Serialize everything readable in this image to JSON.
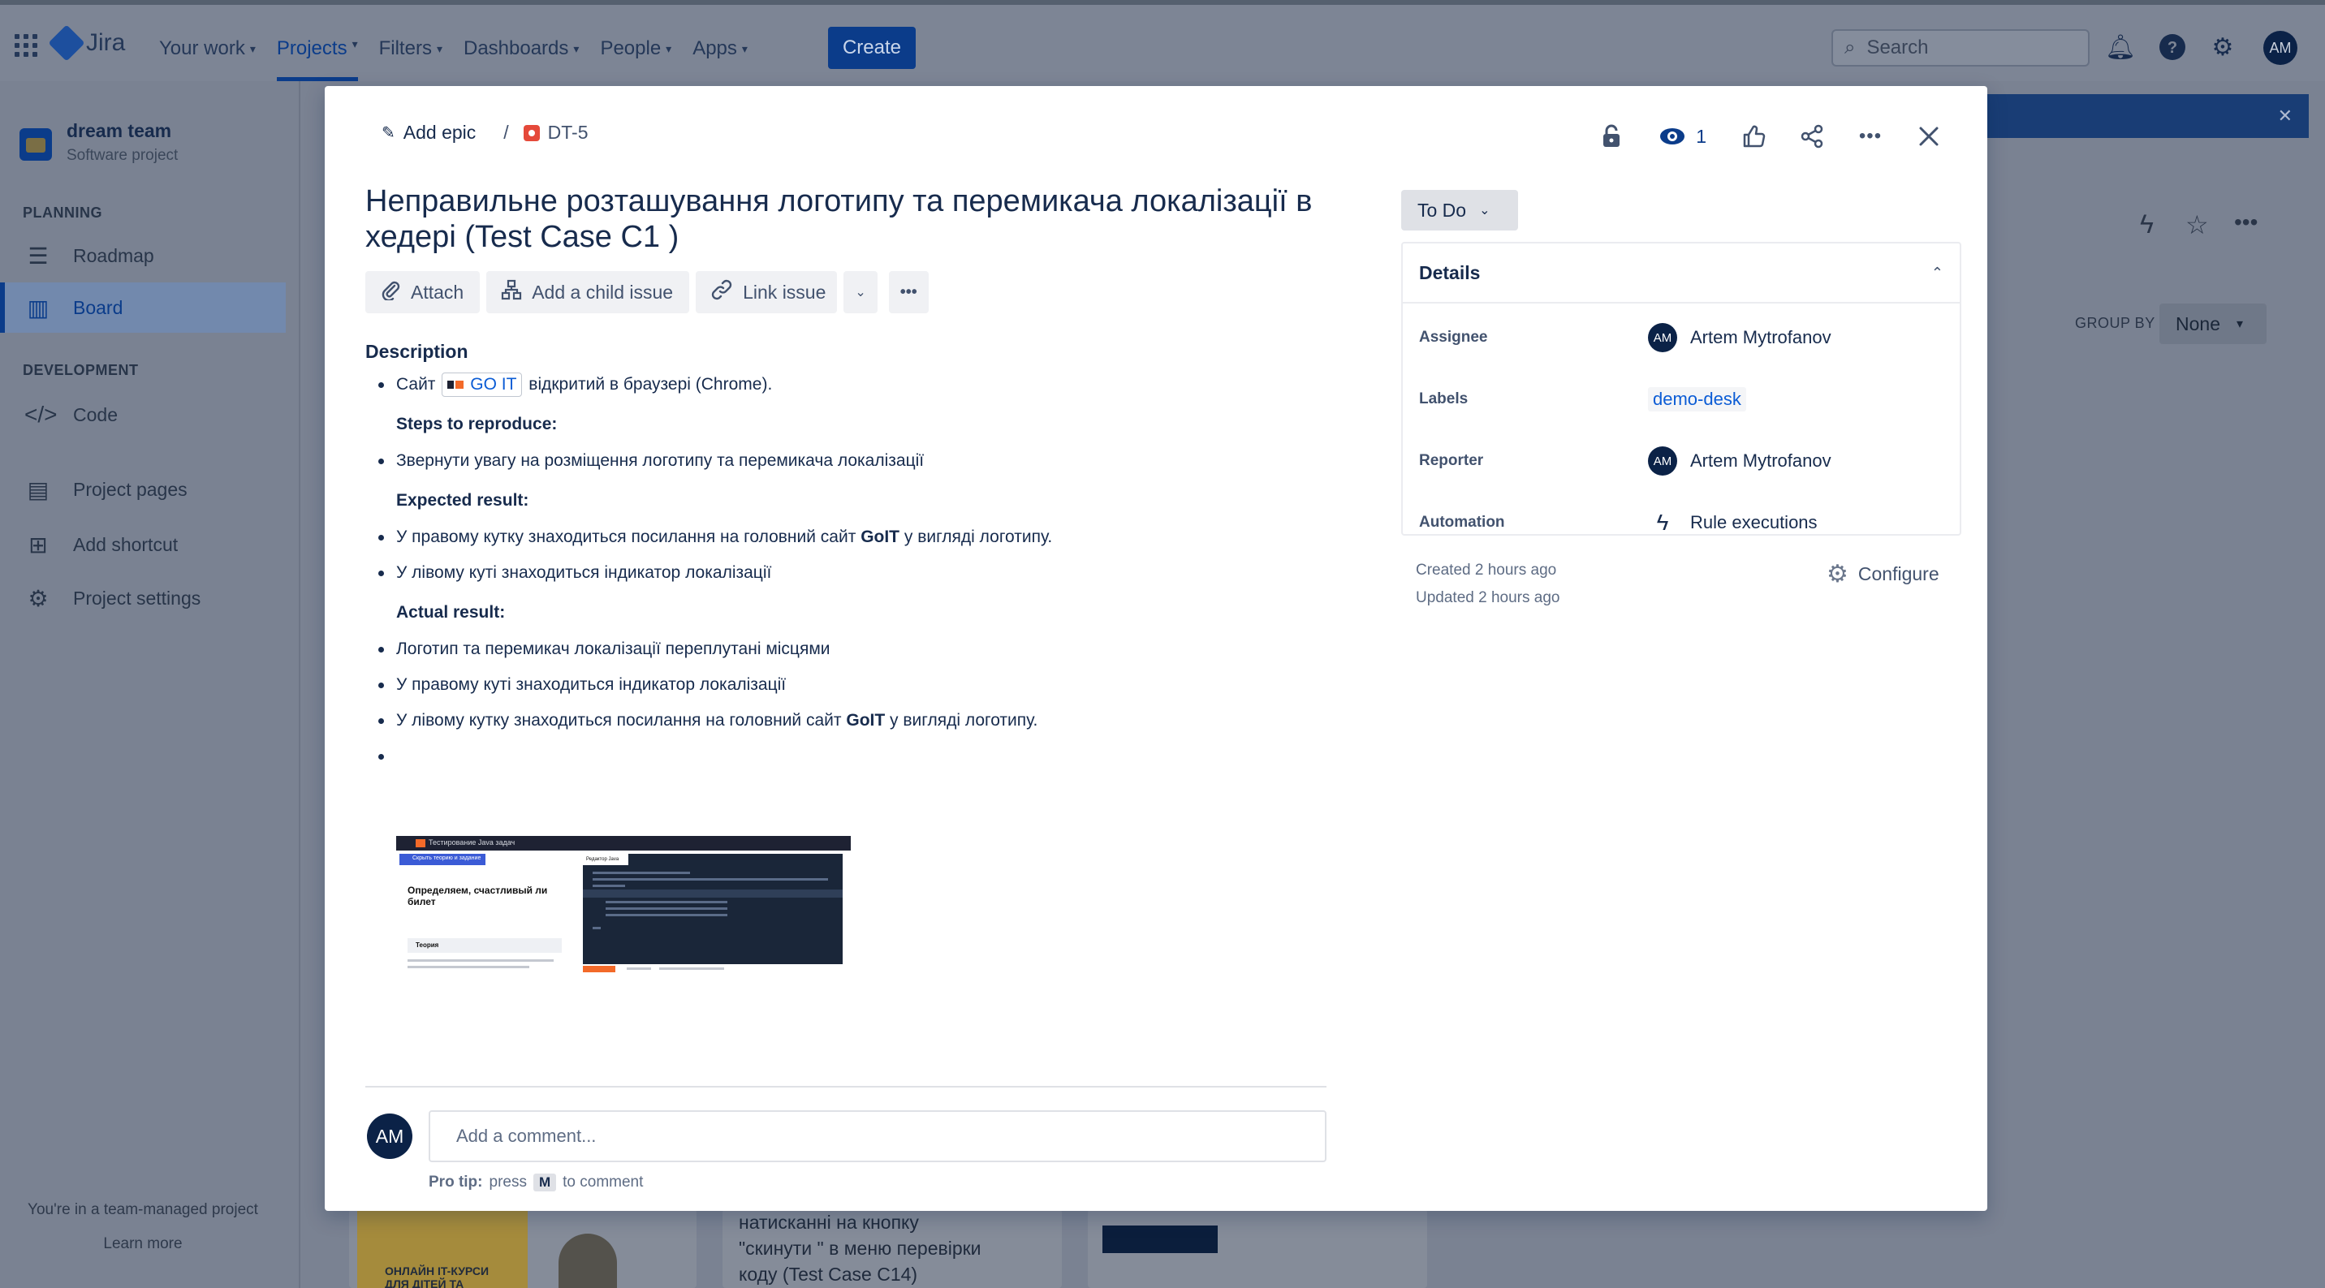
{
  "topbar": {
    "logo": "Jira",
    "nav": [
      {
        "label": "Your work",
        "active": false
      },
      {
        "label": "Projects",
        "active": true
      },
      {
        "label": "Filters",
        "active": false
      },
      {
        "label": "Dashboards",
        "active": false
      },
      {
        "label": "People",
        "active": false
      },
      {
        "label": "Apps",
        "active": false
      }
    ],
    "create_label": "Create",
    "search_placeholder": "Search",
    "avatar_initials": "AM"
  },
  "sidebar": {
    "project_name": "dream team",
    "project_type": "Software project",
    "planning_heading": "PLANNING",
    "roadmap": "Roadmap",
    "board": "Board",
    "development_heading": "DEVELOPMENT",
    "code": "Code",
    "project_pages": "Project pages",
    "add_shortcut": "Add shortcut",
    "project_settings": "Project settings",
    "footer_text": "You're in a team-managed project",
    "learn_more": "Learn more"
  },
  "background": {
    "group_by_label": "GROUP BY",
    "group_by_value": "None",
    "card_text": [
      "натисканні на кнопку",
      "\"скинути \" в меню перевірки",
      "коду (Test Case C14)"
    ],
    "yellow_card_text": [
      "ОНЛАЙН IT-КУРСИ",
      "ДЛЯ ДІТЕЙ ТА"
    ]
  },
  "issue": {
    "add_epic": "Add epic",
    "breadcrumb_sep": "/",
    "key": "DT-5",
    "watchers": "1",
    "title": "Неправильне розташування логотипу та перемикача локалізації в хедері (Test Case C1 )",
    "toolbar": {
      "attach": "Attach",
      "add_child": "Add a child issue",
      "link_issue": "Link issue"
    },
    "description_heading": "Description",
    "description": {
      "site_prefix": "Сайт",
      "site_link": "GO IT",
      "site_suffix": "відкритий в браузері (Chrome).",
      "steps_heading": "Steps to reproduce:",
      "step_1": "Звернути увагу на розміщення логотипу та перемикача локалізації",
      "expected_heading": "Expected result:",
      "expected_1_pre": "У правому кутку знаходиться посилання на головний сайт",
      "expected_1_bold": "GoIT",
      "expected_1_post": "у вигляді логотипу.",
      "expected_2": "У лівому куті знаходиться індикатор локалізації",
      "actual_heading": "Actual result:",
      "actual_1": "Логотип та перемикач локалізації переплутані місцями",
      "actual_2": "У правому куті знаходиться індикатор локалізації",
      "actual_3_pre": "У лівому кутку знаходиться посилання на головний сайт",
      "actual_3_bold": "GoIT",
      "actual_3_post": "у вигляді логотипу."
    },
    "screenshot": {
      "header_text": "Тестирование Java задач",
      "blue_button": "Скрыть теорию и задание",
      "question": "Определяем, счастливый ли билет",
      "theory": "Теория",
      "editor_tab": "Редактор Java"
    },
    "comment_avatar": "AM",
    "comment_placeholder": "Add a comment...",
    "protip_label": "Pro tip:",
    "protip_press": "press",
    "protip_key": "M",
    "protip_suffix": "to comment"
  },
  "details": {
    "status": "To Do",
    "heading": "Details",
    "assignee_label": "Assignee",
    "assignee_name": "Artem Mytrofanov",
    "assignee_initials": "AM",
    "labels_label": "Labels",
    "label_value": "demo-desk",
    "reporter_label": "Reporter",
    "reporter_name": "Artem Mytrofanov",
    "reporter_initials": "AM",
    "automation_label": "Automation",
    "automation_value": "Rule executions",
    "created": "Created 2 hours ago",
    "updated": "Updated 2 hours ago",
    "configure": "Configure"
  },
  "colors": {
    "accent": "#0b5cd5",
    "dark_avatar": "#0b2247",
    "bug": "#e5493a"
  }
}
